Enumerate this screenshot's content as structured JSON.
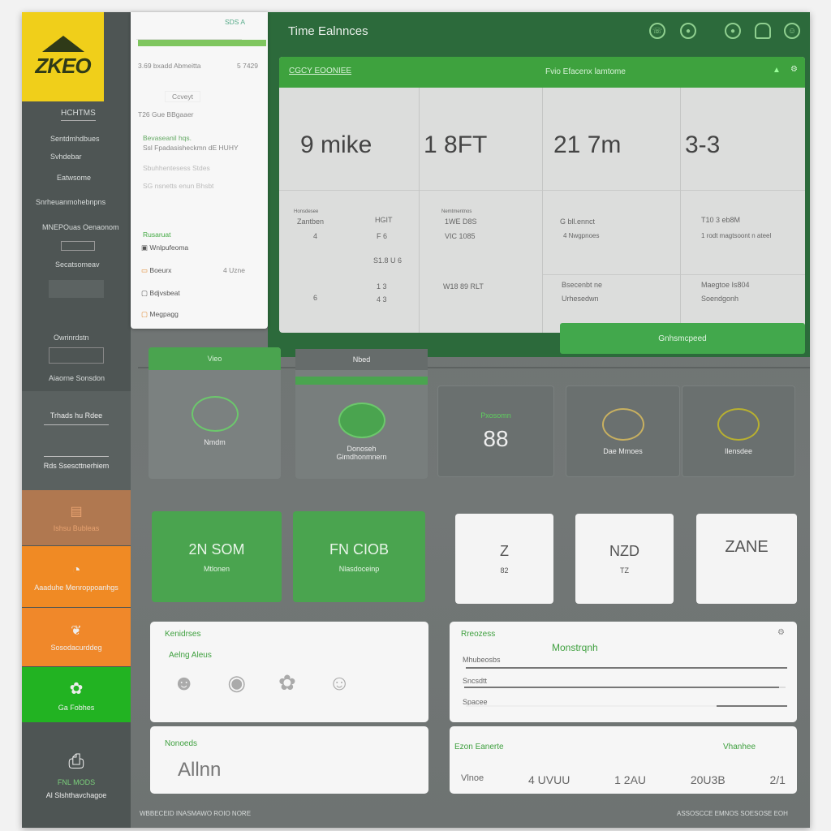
{
  "app": {
    "logo_text": "ZKEO",
    "title": "Time Ealnnces",
    "accent": "#3ea23e",
    "header_color": "#2c6a3b",
    "logo_color": "#f0cf1a"
  },
  "header_icons": [
    "phone-icon",
    "target-icon",
    "settings-circle-icon",
    "lock-icon",
    "user-icon"
  ],
  "sidebar": {
    "heading": "HCHTMS",
    "items": [
      {
        "label": "Sentdmhdbues"
      },
      {
        "label": "Svhdebar"
      },
      {
        "label": "Eatwsome"
      },
      {
        "label": "Snrheuanmohebnpns"
      },
      {
        "label": "MNEPOuas Oenaonom"
      },
      {
        "label": "Secatsomeav"
      },
      {
        "label": "Owrinrdstn"
      },
      {
        "label": "Aiaorne Sonsdon"
      }
    ],
    "blocks": [
      {
        "label": "Trhads hu Rdee",
        "sub": "Rds Ssescttnerhiem"
      },
      {
        "label": "Ishsu Bubleas"
      },
      {
        "label": "Aaaduhe Menroppoanhgs"
      },
      {
        "label": "Sosodacurddeg"
      },
      {
        "label": "Ga Fobhes"
      },
      {
        "label": "FNL MODS",
        "sub": "Al Slshthavchagoe"
      }
    ]
  },
  "dropdown": {
    "top_label": "SDS A",
    "row1": "3.69 bxadd  Abmeitta",
    "row1_value": "5 7429",
    "chip": "Ccveyt",
    "row2": "T26 Gue BBgaaer",
    "desc1": "Bevaseanil hqs.",
    "desc2": "Ssl Fpadasisheckmn dE HUHY",
    "opt1": "Sbuhhentesess  Stdes",
    "opt2": "SG nsnetts enun  Bhsbt",
    "section": "Rusaruat",
    "list": [
      {
        "label": "Wnlpufeoma"
      },
      {
        "label": "Boeurx",
        "value": "4 Uzne"
      },
      {
        "label": "Bdjvsbeat"
      },
      {
        "label": "Megpagg"
      }
    ]
  },
  "stats": {
    "header_left": "CGCY EOONIEE",
    "header_center": "Fvio Efacenx lamtome",
    "columns": [
      {
        "value": "9 mike",
        "label": "Honsdesee",
        "sub": "Zantben",
        "lines": [
          "4",
          "6"
        ],
        "extra": "HGIT",
        "extra_lines": [
          "F 6",
          "S1.8 U 6",
          "1 3",
          "4 3"
        ]
      },
      {
        "value": "1 8FT",
        "label": "Nemtmentnos",
        "sub": "1WE D8S",
        "lines": [
          "VIC 1085",
          "W18 89 RLT"
        ]
      },
      {
        "value": "21 7m",
        "sub": "G bll.ennct",
        "lines": [
          "4 Nwgpnoes",
          "Bsecenbt ne",
          "Urhesedwn"
        ]
      },
      {
        "value": "3-3",
        "sub": "T10 3 eb8M",
        "lines": [
          "1 rodt magtsoont n ateel",
          "Maegtoe Is804",
          "Soendgonh"
        ]
      }
    ],
    "button": "Gnhsmcpeed"
  },
  "row2": [
    {
      "header": "Vieo",
      "label": "Nmdm"
    },
    {
      "header": "Nbed",
      "label": "Donoseh Gimdhonmnern"
    },
    {
      "header": "Pxosomn",
      "value": "88"
    },
    {
      "label": "Dae Mmoes"
    },
    {
      "label": "Ilensdee"
    }
  ],
  "row3": [
    {
      "value": "2N SOM",
      "label": "Mtlonen"
    },
    {
      "value": "FN CIOB",
      "label": "Nlasdoceinp"
    },
    {
      "value": "Z",
      "label": "82"
    },
    {
      "value": "NZD",
      "label": "TZ"
    },
    {
      "value": "ZANE"
    }
  ],
  "panels": {
    "people": {
      "title": "Kenidrses",
      "subtitle": "Aelng Aleus"
    },
    "progress": {
      "title": "Rreozess",
      "subtitle": "Monstrqnh",
      "bars": [
        {
          "label": "Mhubeosbs",
          "value": 100
        },
        {
          "label": "Sncsdtt",
          "value": 98
        },
        {
          "label": "Spacee",
          "value": 22
        }
      ]
    },
    "words": {
      "title": "Nonoeds",
      "value": "Allnn"
    },
    "metrics": {
      "title": "Ezon  Eanerte",
      "right": "Vhanhee",
      "cells": [
        "Vlnoe",
        "4 UVUU",
        "1 2AU",
        "20U3B",
        "2/1"
      ]
    }
  },
  "footer": {
    "left": "WBBECEID INASMAWO ROIO NORE",
    "right": "ASSOSCCE EMNOS  SOESOSE EOH"
  }
}
